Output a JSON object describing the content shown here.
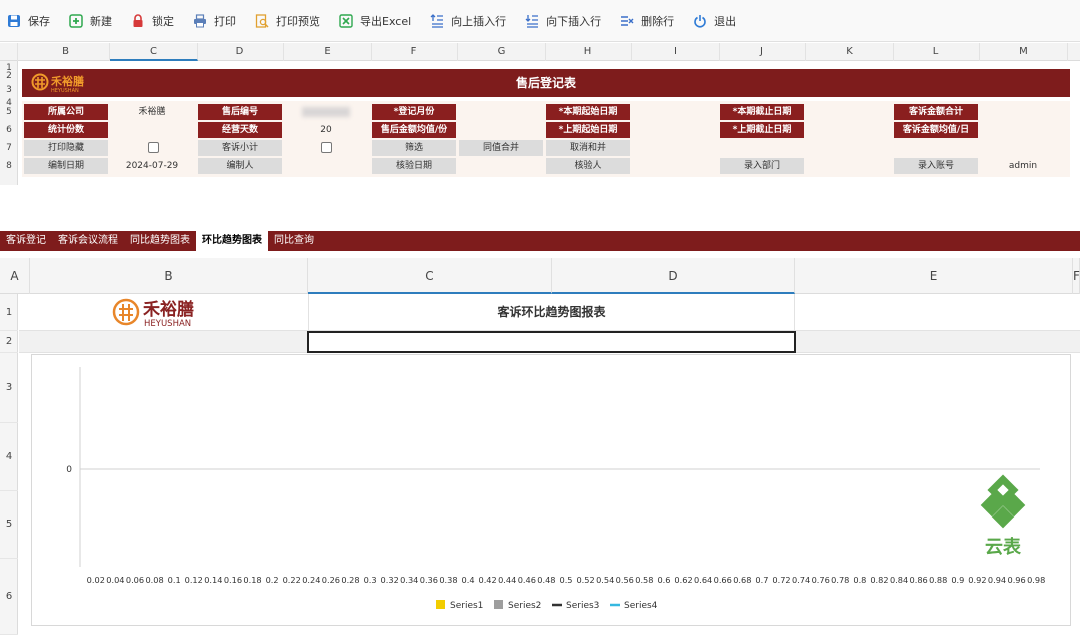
{
  "toolbar": {
    "items": [
      {
        "label": "保存",
        "icon": "save-icon",
        "color": "#2f7bd6"
      },
      {
        "label": "新建",
        "icon": "new-icon",
        "color": "#2fa84f"
      },
      {
        "label": "锁定",
        "icon": "lock-icon",
        "color": "#d63a3a"
      },
      {
        "label": "打印",
        "icon": "print-icon",
        "color": "#5b7fb8"
      },
      {
        "label": "打印预览",
        "icon": "print-preview-icon",
        "color": "#e0a030"
      },
      {
        "label": "导出Excel",
        "icon": "excel-icon",
        "color": "#2fa84f"
      },
      {
        "label": "向上插入行",
        "icon": "insert-row-above-icon",
        "color": "#3a6fc9"
      },
      {
        "label": "向下插入行",
        "icon": "insert-row-below-icon",
        "color": "#3a6fc9"
      },
      {
        "label": "删除行",
        "icon": "delete-row-icon",
        "color": "#3a6fc9"
      },
      {
        "label": "退出",
        "icon": "power-icon",
        "color": "#2f7bd6"
      }
    ]
  },
  "sheet1": {
    "columns": [
      "B",
      "C",
      "D",
      "E",
      "F",
      "G",
      "H",
      "I",
      "J",
      "K",
      "L",
      "M"
    ],
    "selected_column": "C",
    "rows": [
      "1",
      "2",
      "3",
      "4",
      "5",
      "6",
      "7",
      "8"
    ],
    "title": "售后登记表",
    "logo_cn": "禾裕膳",
    "logo_en": "HEYUSHAN",
    "form": {
      "company_label": "所属公司",
      "company_value": "禾裕膳",
      "after_sale_no_label": "售后编号",
      "reg_month_label": "*登记月份",
      "period_start_label": "*本期起始日期",
      "period_end_label": "*本期截止日期",
      "complaint_total_label": "客诉金额合计",
      "stat_count_label": "统计份数",
      "business_days_label": "经营天数",
      "business_days_value": "20",
      "avg_per_copy_label": "售后金额均值/份",
      "prev_start_label": "*上期起始日期",
      "prev_end_label": "*上期截止日期",
      "daily_avg_label": "客诉金额均值/日",
      "print_hide_label": "打印隐藏",
      "subtotal_label": "客诉小计",
      "filter_label": "筛选",
      "merge_same_label": "同值合并",
      "unmerge_label": "取消和并",
      "made_date_label": "编制日期",
      "made_date_value": "2024-07-29",
      "maker_label": "编制人",
      "check_date_label": "核验日期",
      "checker_label": "核验人",
      "dept_label": "录入部门",
      "account_label": "录入账号",
      "account_value": "admin"
    }
  },
  "tabs": [
    {
      "label": "客诉登记",
      "active": false
    },
    {
      "label": "客诉会议流程",
      "active": false
    },
    {
      "label": "同比趋势图表",
      "active": false
    },
    {
      "label": "环比趋势图表",
      "active": true
    },
    {
      "label": "同比查询",
      "active": false
    }
  ],
  "sheet2": {
    "columns": [
      "A",
      "B",
      "C",
      "D",
      "E",
      "F"
    ],
    "rows": [
      "1",
      "2",
      "3",
      "4",
      "5",
      "6"
    ],
    "title": "客诉环比趋势图报表",
    "logo_cn": "禾裕膳",
    "logo_en": "HEYUSHAN",
    "watermark_text": "云表"
  },
  "chart_data": {
    "type": "line",
    "x": [
      "0.02",
      "0.04",
      "0.06",
      "0.08",
      "0.1",
      "0.12",
      "0.14",
      "0.16",
      "0.18",
      "0.2",
      "0.22",
      "0.24",
      "0.26",
      "0.28",
      "0.3",
      "0.32",
      "0.34",
      "0.36",
      "0.38",
      "0.4",
      "0.42",
      "0.44",
      "0.46",
      "0.48",
      "0.5",
      "0.52",
      "0.54",
      "0.56",
      "0.58",
      "0.6",
      "0.62",
      "0.64",
      "0.66",
      "0.68",
      "0.7",
      "0.72",
      "0.74",
      "0.76",
      "0.78",
      "0.8",
      "0.82",
      "0.84",
      "0.86",
      "0.88",
      "0.9",
      "0.92",
      "0.94",
      "0.96",
      "0.98"
    ],
    "y_ticks": [
      "0"
    ],
    "series": [
      {
        "name": "Series1",
        "kind": "bar",
        "color": "#f2cd00",
        "values": []
      },
      {
        "name": "Series2",
        "kind": "bar",
        "color": "#9e9e9e",
        "values": []
      },
      {
        "name": "Series3",
        "kind": "line",
        "color": "#333333",
        "values": []
      },
      {
        "name": "Series4",
        "kind": "line",
        "color": "#35b8e0",
        "values": []
      }
    ],
    "legend": "bottom",
    "grid": false
  }
}
